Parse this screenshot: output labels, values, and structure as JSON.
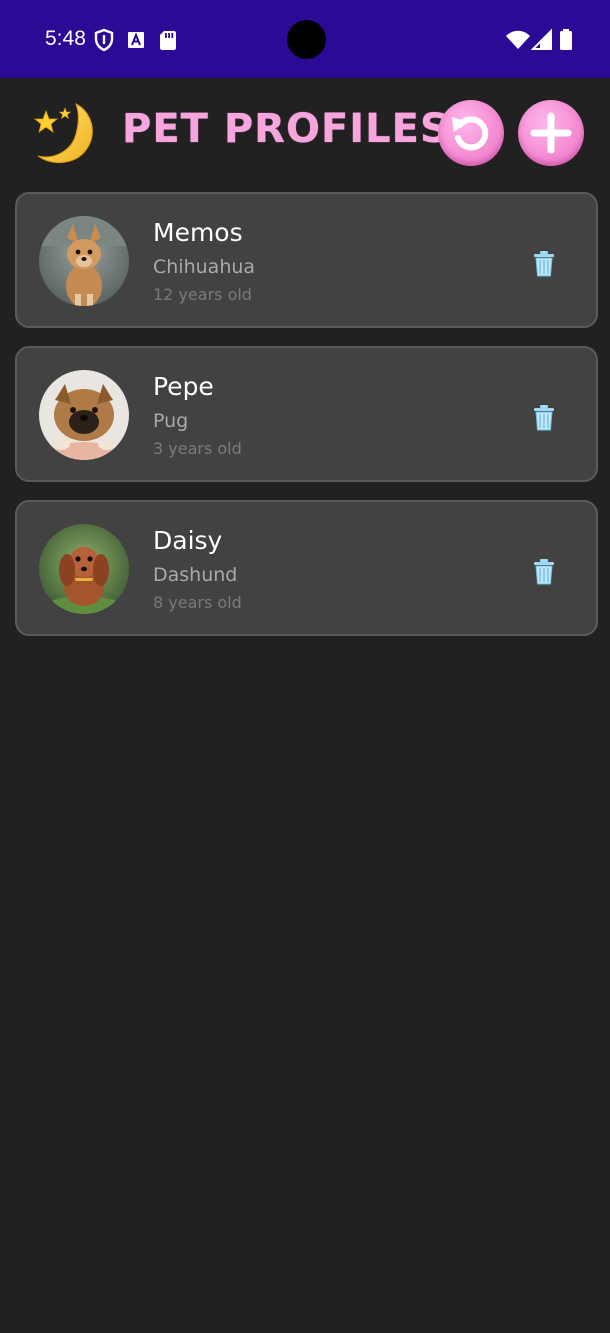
{
  "status_bar": {
    "time": "5:48",
    "icons": [
      "shield-icon",
      "font-a-icon",
      "sd-card-icon",
      "wifi-icon",
      "signal-icon",
      "battery-icon"
    ],
    "background_color": "#2b0a96"
  },
  "header": {
    "title": "PET PROFILES",
    "theme_toggle_icon": "moon-stars-icon",
    "refresh_icon": "refresh-icon",
    "add_icon": "plus-icon",
    "accent_color": "#f7a6dd"
  },
  "pets": [
    {
      "name": "Memos",
      "breed": "Chihuahua",
      "age": "12 years old",
      "delete_icon": "trash-icon"
    },
    {
      "name": "Pepe",
      "breed": "Pug",
      "age": "3 years old",
      "delete_icon": "trash-icon"
    },
    {
      "name": "Daisy",
      "breed": "Dashund",
      "age": "8 years old",
      "delete_icon": "trash-icon"
    }
  ],
  "colors": {
    "background": "#212121",
    "card": "#424242",
    "name_text": "#ffffff",
    "breed_text": "#a9a9a9",
    "age_text": "#7a7a7a"
  }
}
